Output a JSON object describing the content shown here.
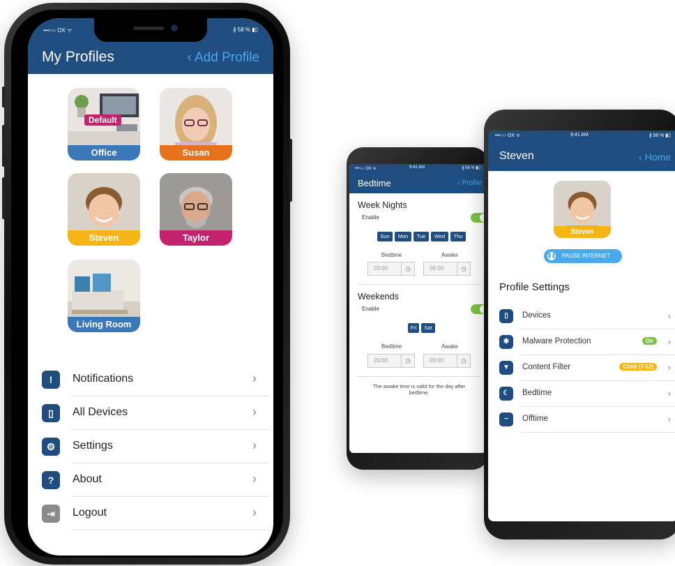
{
  "profiles_screen": {
    "status_left": "•••○○ OX ᯤ",
    "status_right": "∦ 58 % ▮▯",
    "title": "My Profiles",
    "add_profile": "‹ Add Profile",
    "profiles": [
      {
        "label": "Office",
        "badge": "Default",
        "color": "#3b78b8"
      },
      {
        "label": "Susan",
        "color": "#e8711b"
      },
      {
        "label": "Steven",
        "color": "#f5b514"
      },
      {
        "label": "Taylor",
        "color": "#c4226e"
      },
      {
        "label": "Living Room",
        "color": "#3b78b8"
      }
    ],
    "menu": [
      {
        "label": "Notifications",
        "icon": "notification-icon",
        "glyph": "!"
      },
      {
        "label": "All Devices",
        "icon": "phone-icon",
        "glyph": "▯"
      },
      {
        "label": "Settings",
        "icon": "gear-icon",
        "glyph": "⚙"
      },
      {
        "label": "About",
        "icon": "help-icon",
        "glyph": "?"
      },
      {
        "label": "Logout",
        "icon": "logout-icon",
        "glyph": "⇥"
      }
    ],
    "chevron": "›"
  },
  "bedtime_screen": {
    "status_left": "•••○○ OX ᯤ",
    "status_time": "9:41 AM",
    "status_right": "∦ 58 % ▮▯",
    "title": "Bedtime",
    "back": "‹ Profile",
    "week_nights": {
      "title": "Week Nights",
      "enable": "Enable",
      "days": [
        "Sun",
        "Mon",
        "Tue",
        "Wed",
        "Thu"
      ],
      "bedtime_label": "Bedtime",
      "awake_label": "Awake",
      "bedtime": "20:00",
      "awake": "06:00"
    },
    "weekends": {
      "title": "Weekends",
      "enable": "Enable",
      "days": [
        "Fri",
        "Sat"
      ],
      "bedtime_label": "Bedtime",
      "awake_label": "Awake",
      "bedtime": "20:00",
      "awake": "09:00"
    },
    "note": "The awake time is valid for the day after bedtime."
  },
  "steven_screen": {
    "status_left": "•••○○ OX ᯤ",
    "status_time": "9:41 AM",
    "status_right": "∦ 58 % ▮▯",
    "title": "Steven",
    "home": "‹ Home",
    "profile_label": "Steven",
    "pause_button": "PAUSE INTERNET",
    "section_title": "Profile Settings",
    "rows": [
      {
        "label": "Devices",
        "icon": "phone-icon",
        "glyph": "▯"
      },
      {
        "label": "Malware Protection",
        "icon": "bug-icon",
        "glyph": "✱",
        "pill": "On",
        "pill_color": "#7cc33f"
      },
      {
        "label": "Content Filter",
        "icon": "filter-icon",
        "glyph": "▼",
        "pill": "Child (7-12)",
        "pill_color": "#f5b514"
      },
      {
        "label": "Bedtime",
        "icon": "moon-icon",
        "glyph": "☾"
      },
      {
        "label": "Offtime",
        "icon": "minus-circle-icon",
        "glyph": "−"
      }
    ],
    "chevron": "›"
  },
  "colors": {
    "nav": "#1f4d7f",
    "link": "#4aa8ec",
    "toggle_on": "#7cc33f",
    "pause_button": "#4aa8ec"
  }
}
